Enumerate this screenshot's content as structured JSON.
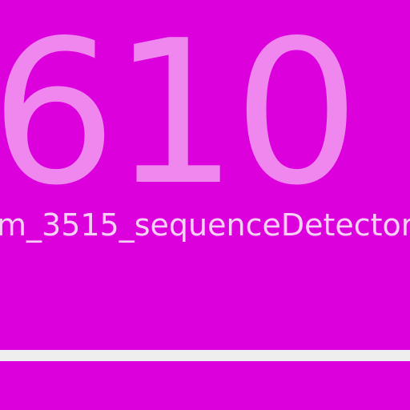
{
  "screen": {
    "number": "610",
    "label": "m_3515_sequenceDetector"
  },
  "colors": {
    "background": "#dc00dc",
    "number": "#ef87ef",
    "label": "#f6d0f6",
    "bar": "#eeeeee"
  }
}
